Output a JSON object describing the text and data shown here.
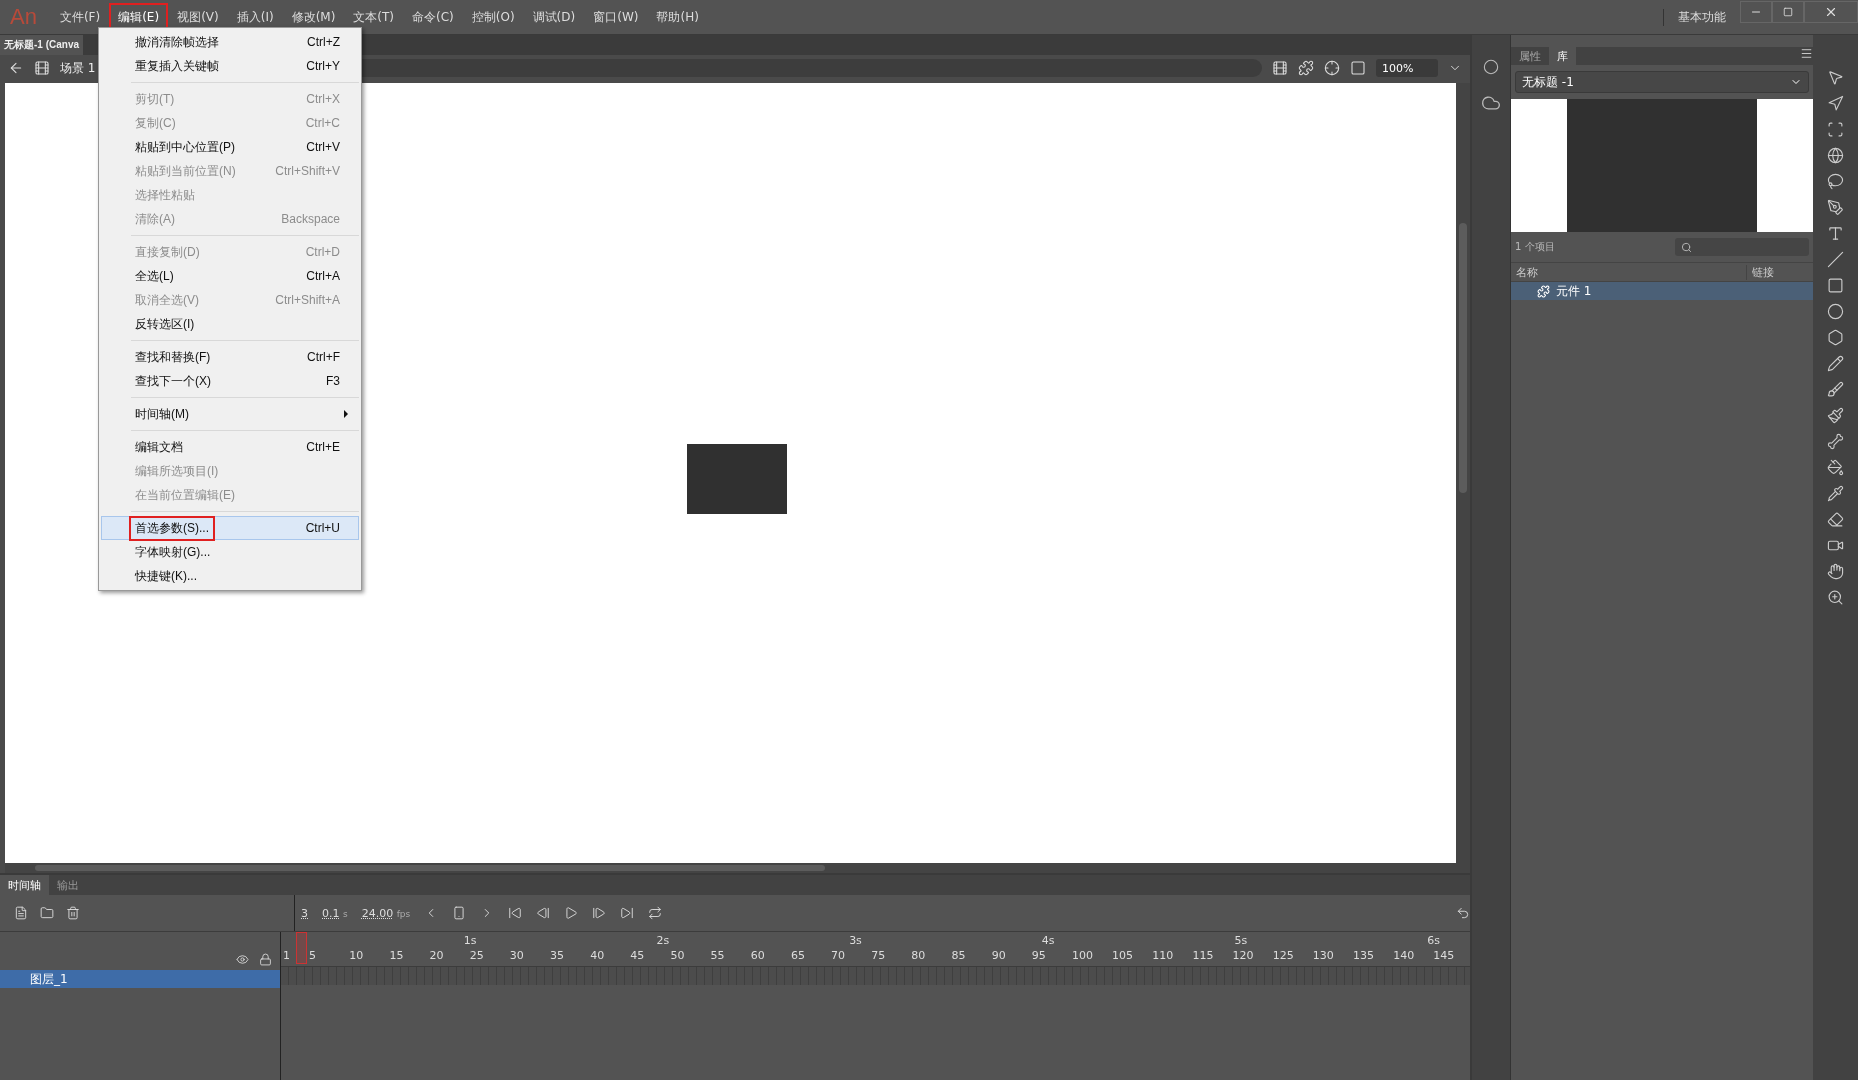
{
  "menu_bar": {
    "logo": "An",
    "items": [
      {
        "label": "文件(F)",
        "selected": false,
        "annotated": false
      },
      {
        "label": "编辑(E)",
        "selected": true,
        "annotated": true
      },
      {
        "label": "视图(V)",
        "selected": false,
        "annotated": false
      },
      {
        "label": "插入(I)",
        "selected": false,
        "annotated": false
      },
      {
        "label": "修改(M)",
        "selected": false,
        "annotated": false
      },
      {
        "label": "文本(T)",
        "selected": false,
        "annotated": false
      },
      {
        "label": "命令(C)",
        "selected": false,
        "annotated": false
      },
      {
        "label": "控制(O)",
        "selected": false,
        "annotated": false
      },
      {
        "label": "调试(D)",
        "selected": false,
        "annotated": false
      },
      {
        "label": "窗口(W)",
        "selected": false,
        "annotated": false
      },
      {
        "label": "帮助(H)",
        "selected": false,
        "annotated": false
      }
    ],
    "workspace": "基本功能"
  },
  "document_tab": "无标题-1 (Canva",
  "scene": "场景 1",
  "zoom": "100%",
  "edit_menu": {
    "groups": [
      [
        {
          "label": "撤消清除帧选择",
          "shortcut": "Ctrl+Z",
          "disabled": false,
          "selected": false,
          "annotated": false,
          "submenu": false
        },
        {
          "label": "重复插入关键帧",
          "shortcut": "Ctrl+Y",
          "disabled": false,
          "selected": false,
          "annotated": false,
          "submenu": false
        }
      ],
      [
        {
          "label": "剪切(T)",
          "shortcut": "Ctrl+X",
          "disabled": true,
          "selected": false,
          "annotated": false,
          "submenu": false
        },
        {
          "label": "复制(C)",
          "shortcut": "Ctrl+C",
          "disabled": true,
          "selected": false,
          "annotated": false,
          "submenu": false
        },
        {
          "label": "粘贴到中心位置(P)",
          "shortcut": "Ctrl+V",
          "disabled": false,
          "selected": false,
          "annotated": false,
          "submenu": false
        },
        {
          "label": "粘贴到当前位置(N)",
          "shortcut": "Ctrl+Shift+V",
          "disabled": true,
          "selected": false,
          "annotated": false,
          "submenu": false
        },
        {
          "label": "选择性粘贴",
          "disabled": true,
          "selected": false,
          "annotated": false,
          "submenu": false
        },
        {
          "label": "清除(A)",
          "shortcut": "Backspace",
          "disabled": true,
          "selected": false,
          "annotated": false,
          "submenu": false
        }
      ],
      [
        {
          "label": "直接复制(D)",
          "shortcut": "Ctrl+D",
          "disabled": true,
          "selected": false,
          "annotated": false,
          "submenu": false
        },
        {
          "label": "全选(L)",
          "shortcut": "Ctrl+A",
          "disabled": false,
          "selected": false,
          "annotated": false,
          "submenu": false
        },
        {
          "label": "取消全选(V)",
          "shortcut": "Ctrl+Shift+A",
          "disabled": true,
          "selected": false,
          "annotated": false,
          "submenu": false
        },
        {
          "label": "反转选区(I)",
          "disabled": false,
          "selected": false,
          "annotated": false,
          "submenu": false
        }
      ],
      [
        {
          "label": "查找和替换(F)",
          "shortcut": "Ctrl+F",
          "disabled": false,
          "selected": false,
          "annotated": false,
          "submenu": false
        },
        {
          "label": "查找下一个(X)",
          "shortcut": "F3",
          "disabled": false,
          "selected": false,
          "annotated": false,
          "submenu": false
        }
      ],
      [
        {
          "label": "时间轴(M)",
          "disabled": false,
          "selected": false,
          "annotated": false,
          "submenu": true
        }
      ],
      [
        {
          "label": "编辑文档",
          "shortcut": "Ctrl+E",
          "disabled": false,
          "selected": false,
          "annotated": false,
          "submenu": false
        },
        {
          "label": "编辑所选项目(I)",
          "disabled": true,
          "selected": false,
          "annotated": false,
          "submenu": false
        },
        {
          "label": "在当前位置编辑(E)",
          "disabled": true,
          "selected": false,
          "annotated": false,
          "submenu": false
        }
      ],
      [
        {
          "label": "首选参数(S)...",
          "shortcut": "Ctrl+U",
          "disabled": false,
          "selected": true,
          "annotated": true,
          "submenu": false
        },
        {
          "label": "字体映射(G)...",
          "disabled": false,
          "selected": false,
          "annotated": false,
          "submenu": false
        },
        {
          "label": "快捷键(K)...",
          "disabled": false,
          "selected": false,
          "annotated": false,
          "submenu": false
        }
      ]
    ]
  },
  "library": {
    "tabs": [
      {
        "label": "属性",
        "selected": false
      },
      {
        "label": "库",
        "selected": true
      }
    ],
    "document": "无标题 -1",
    "count": "1 个项目",
    "columns": [
      "名称",
      "链接"
    ],
    "items": [
      {
        "name": "元件 1",
        "selected": true
      }
    ]
  },
  "timeline": {
    "tabs": [
      {
        "label": "时间轴",
        "selected": true
      },
      {
        "label": "输出",
        "selected": false
      }
    ],
    "frame": "3",
    "time": "0.1",
    "time_unit": "s",
    "fps": "24.00",
    "fps_unit": "fps",
    "seconds": [
      "1s",
      "2s",
      "3s",
      "4s",
      "5s",
      "6s"
    ],
    "frame_numbers": [
      "1",
      "5",
      "10",
      "15",
      "20",
      "25",
      "30",
      "35",
      "40",
      "45",
      "50",
      "55",
      "60",
      "65",
      "70",
      "75",
      "80",
      "85",
      "90",
      "95",
      "100",
      "105",
      "110",
      "115",
      "120",
      "125",
      "130",
      "135",
      "140",
      "145"
    ],
    "layers": [
      {
        "name": "图层_1",
        "selected": true
      }
    ]
  }
}
